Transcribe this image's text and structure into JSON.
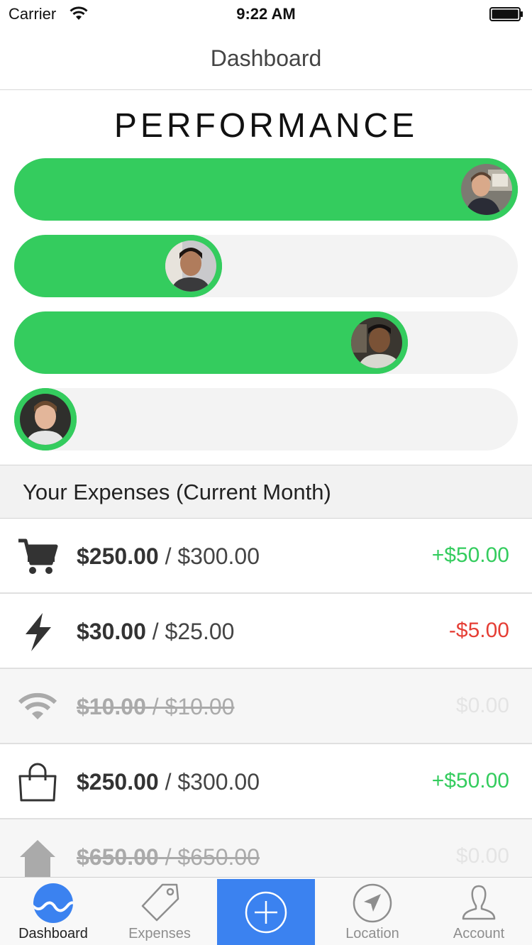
{
  "status_bar": {
    "carrier": "Carrier",
    "time": "9:22 AM"
  },
  "nav": {
    "title": "Dashboard"
  },
  "performance": {
    "title": "PERFORMANCE",
    "bars": [
      {
        "level": 1.0,
        "avatar": "person-avatar-1"
      },
      {
        "level": 0.33,
        "avatar": "person-avatar-2"
      },
      {
        "level": 0.75,
        "avatar": "person-avatar-3"
      },
      {
        "level": 0.0,
        "avatar": "person-avatar-4"
      }
    ]
  },
  "expenses": {
    "header": "Your Expenses (Current Month)",
    "rows": [
      {
        "icon": "cart-icon",
        "spent": "$250.00",
        "budget": "/ $300.00",
        "diff": "+$50.00",
        "state": "positive"
      },
      {
        "icon": "lightning-icon",
        "spent": "$30.00",
        "budget": "/ $25.00",
        "diff": "-$5.00",
        "state": "negative"
      },
      {
        "icon": "wifi-icon",
        "spent": "$10.00",
        "budget": "/ $10.00",
        "diff": "$0.00",
        "state": "settled"
      },
      {
        "icon": "shopping-bag-icon",
        "spent": "$250.00",
        "budget": "/ $300.00",
        "diff": "+$50.00",
        "state": "positive"
      },
      {
        "icon": "house-icon",
        "spent": "$650.00",
        "budget": "/ $650.00",
        "diff": "$0.00",
        "state": "settled"
      }
    ]
  },
  "tab_bar": {
    "tabs": [
      {
        "label": "Dashboard",
        "icon": "wave-circle-icon",
        "active": true
      },
      {
        "label": "Expenses",
        "icon": "price-tag-icon"
      },
      {
        "label": "",
        "icon": "plus-circle-icon"
      },
      {
        "label": "Location",
        "icon": "navigation-arrow-icon"
      },
      {
        "label": "Account",
        "icon": "user-icon"
      }
    ]
  },
  "colors": {
    "green": "#34cc5e",
    "red": "#e53e35",
    "blue": "#3b82f0",
    "track": "#f3f3f3"
  }
}
